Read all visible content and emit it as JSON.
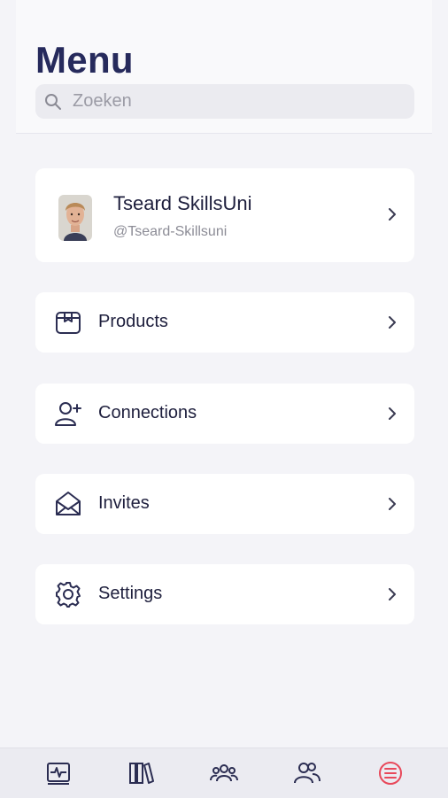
{
  "header": {
    "title": "Menu",
    "search_placeholder": "Zoeken"
  },
  "profile": {
    "name": "Tseard SkillsUni",
    "handle": "@Tseard-Skillsuni"
  },
  "menu": {
    "items": [
      {
        "label": "Products",
        "icon": "box-icon"
      },
      {
        "label": "Connections",
        "icon": "add-person-icon"
      },
      {
        "label": "Invites",
        "icon": "envelope-icon"
      },
      {
        "label": "Settings",
        "icon": "gear-icon"
      }
    ]
  },
  "bottom_nav": {
    "tabs": [
      {
        "icon": "activity-monitor-icon",
        "active": false
      },
      {
        "icon": "library-icon",
        "active": false
      },
      {
        "icon": "group-icon",
        "active": false
      },
      {
        "icon": "people-icon",
        "active": false
      },
      {
        "icon": "list-icon",
        "active": true
      }
    ]
  },
  "colors": {
    "title": "#262a5c",
    "text": "#1e1f3d",
    "icon": "#2b2d52",
    "active_tab": "#e8485a",
    "background": "#f4f4f8"
  }
}
